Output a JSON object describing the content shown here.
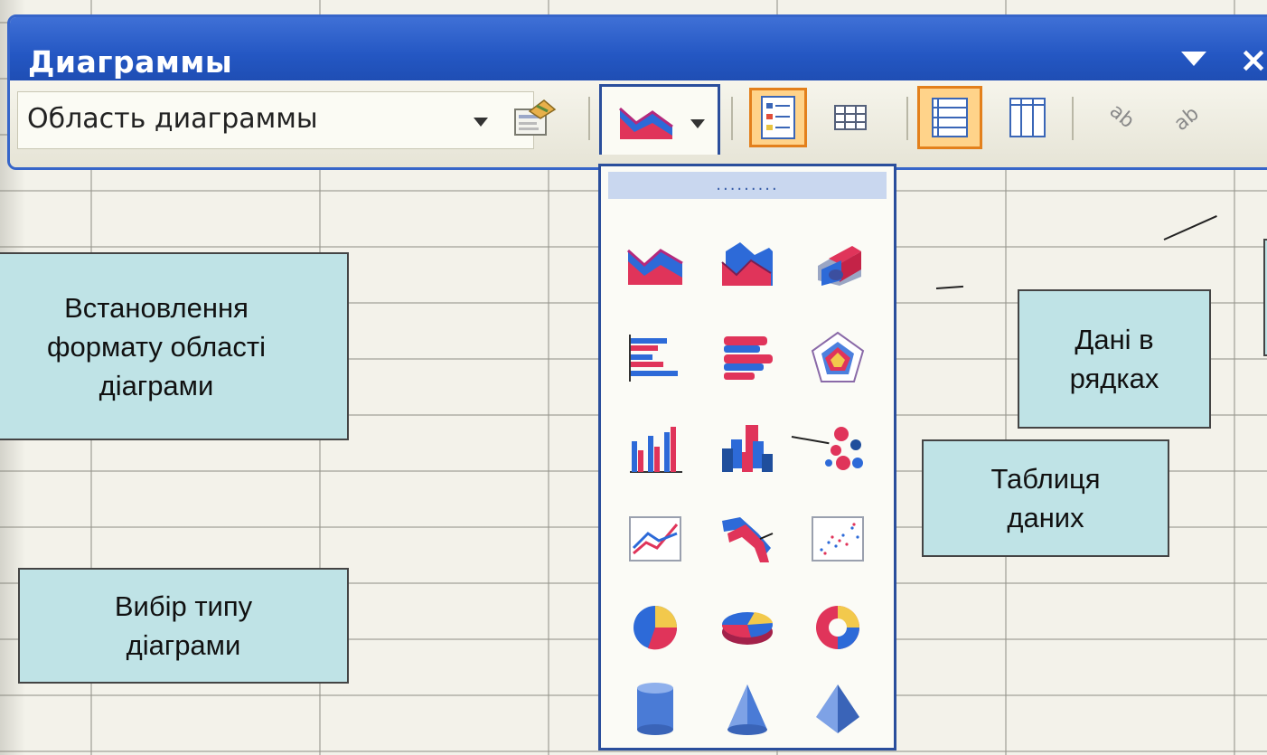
{
  "toolbar": {
    "title": "Диаграммы",
    "area_select": {
      "value": "Область диаграммы"
    },
    "buttons": [
      {
        "name": "format-chart-area",
        "icon": "format-chart-area-icon"
      },
      {
        "name": "chart-type",
        "icon": "area-chart-icon",
        "dropdown_open": true
      },
      {
        "name": "legend",
        "icon": "legend-icon",
        "pressed": true
      },
      {
        "name": "data-table",
        "icon": "data-table-icon",
        "pressed": false
      },
      {
        "name": "by-row",
        "icon": "by-row-icon",
        "pressed": true
      },
      {
        "name": "by-column",
        "icon": "by-column-icon",
        "pressed": false
      },
      {
        "name": "angle-text-downward",
        "icon": "angle-text-down-icon"
      },
      {
        "name": "angle-text-upward",
        "icon": "angle-text-up-icon"
      }
    ]
  },
  "palette": {
    "chart_types": [
      [
        "area-chart",
        "area-3d-chart",
        "area-3d-perspective-chart"
      ],
      [
        "bar-chart",
        "bar-3d-chart",
        "radar-chart"
      ],
      [
        "column-chart",
        "column-3d-chart",
        "bubble-chart"
      ],
      [
        "line-chart",
        "line-3d-chart",
        "xy-scatter-chart"
      ],
      [
        "pie-chart",
        "pie-3d-chart",
        "doughnut-chart"
      ],
      [
        "cylinder-chart",
        "cone-chart",
        "pyramid-chart"
      ]
    ]
  },
  "callouts": {
    "format_area": [
      "Встановлення",
      "формату області",
      "діаграми"
    ],
    "chart_type": [
      "Вибір типу",
      "діаграми"
    ],
    "by_rows": [
      "Дані в",
      "рядках"
    ],
    "data_table": [
      "Таблиця",
      "даних"
    ]
  },
  "colors": {
    "title_bar": "#2457c3",
    "pressed_button": "#ffd38a",
    "callout_bg": "#bfe3e6"
  }
}
